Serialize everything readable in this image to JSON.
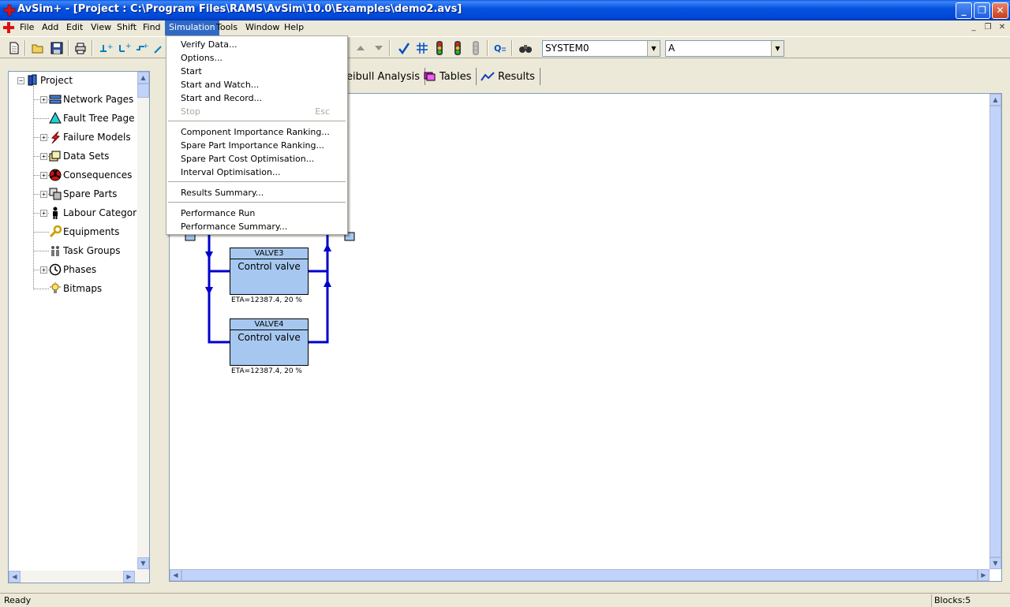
{
  "window": {
    "title": "AvSim+ - [Project : C:\\Program Files\\RAMS\\AvSim\\10.0\\Examples\\demo2.avs]"
  },
  "menubar": {
    "items": [
      "File",
      "Add",
      "Edit",
      "View",
      "Shift",
      "Find",
      "Simulation",
      "Tools",
      "Window",
      "Help"
    ],
    "active": "Simulation"
  },
  "toolbar": {
    "system_combo": "SYSTEM0",
    "second_combo": "A"
  },
  "simulation_menu": {
    "items": [
      {
        "label": "Verify Data..."
      },
      {
        "label": "Options..."
      },
      {
        "label": "Start"
      },
      {
        "label": "Start and Watch..."
      },
      {
        "label": "Start and Record..."
      },
      {
        "label": "Stop",
        "shortcut": "Esc",
        "disabled": true
      },
      {
        "label": "Component Importance Ranking..."
      },
      {
        "label": "Spare Part Importance Ranking..."
      },
      {
        "label": "Spare Part Cost Optimisation..."
      },
      {
        "label": "Interval Optimisation..."
      },
      {
        "label": "Results Summary..."
      },
      {
        "label": "Performance Run"
      },
      {
        "label": "Performance Summary..."
      }
    ]
  },
  "tree": {
    "root": "Project",
    "items": [
      {
        "label": "Network Pages",
        "icon": "network-pages-icon"
      },
      {
        "label": "Fault Tree Page",
        "icon": "fault-tree-icon"
      },
      {
        "label": "Failure Models",
        "icon": "failure-models-icon"
      },
      {
        "label": "Data Sets",
        "icon": "data-sets-icon"
      },
      {
        "label": "Consequences",
        "icon": "consequences-icon"
      },
      {
        "label": "Spare Parts",
        "icon": "spare-parts-icon"
      },
      {
        "label": "Labour Categori",
        "icon": "labour-icon"
      },
      {
        "label": "Equipments",
        "icon": "equipments-icon"
      },
      {
        "label": "Task Groups",
        "icon": "task-groups-icon"
      },
      {
        "label": "Phases",
        "icon": "phases-icon"
      },
      {
        "label": "Bitmaps",
        "icon": "bitmaps-icon"
      }
    ]
  },
  "tabs": [
    {
      "label": "eibull Analysis"
    },
    {
      "label": "Tables"
    },
    {
      "label": "Results"
    }
  ],
  "diagram": {
    "blocks": [
      {
        "name": "VALVE3",
        "desc": "Control valve",
        "eta": "ETA=12387.4, 20 %"
      },
      {
        "name": "VALVE4",
        "desc": "Control valve",
        "eta": "ETA=12387.4, 20 %"
      }
    ]
  },
  "status": {
    "left": "Ready",
    "right": "Blocks:5"
  },
  "colors": {
    "titlebar": "#0046d5",
    "menu_highlight": "#316ac5",
    "block_fill": "#a6c8f0",
    "connector": "#0000cc"
  }
}
